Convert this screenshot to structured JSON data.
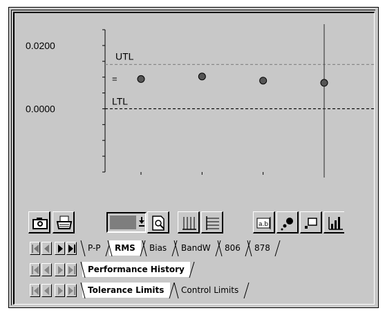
{
  "chart_data": {
    "type": "scatter",
    "y_tick_labels": [
      "0.0200",
      "0.0000"
    ],
    "ylim": [
      -0.02,
      0.025
    ],
    "points": [
      0.0094,
      0.0102,
      0.0089,
      0.0082
    ],
    "limit_lines": [
      {
        "label": "UTL",
        "value": 0.014,
        "style": "dashed",
        "color": "#888888"
      },
      {
        "label": "LTL",
        "value": 0.0,
        "style": "dashed",
        "color": "#000000"
      }
    ],
    "center_marker_label": "=",
    "cursor_index": 3
  },
  "toolbar": {
    "buttons": [
      "camera-icon",
      "printer-icon",
      "color-picker",
      "preview-icon",
      "vertical-grid-icon",
      "horizontal-grid-icon",
      "data-label-icon",
      "marker-icon",
      "frame-icon",
      "bar-chart-icon"
    ],
    "swatch_color": "#7e7e7e"
  },
  "tabs": {
    "parameters": [
      "P-P",
      "RMS",
      "Bias",
      "BandW",
      "806",
      "878"
    ],
    "parameters_selected": "RMS",
    "views": [
      "Performance History"
    ],
    "views_selected": "Performance History",
    "limits": [
      "Tolerance Limits",
      "Control Limits"
    ],
    "limits_selected": "Tolerance Limits"
  },
  "colors": {
    "window": "#c8c8c8",
    "active_tab": "#ffffff",
    "point": "#555555"
  }
}
